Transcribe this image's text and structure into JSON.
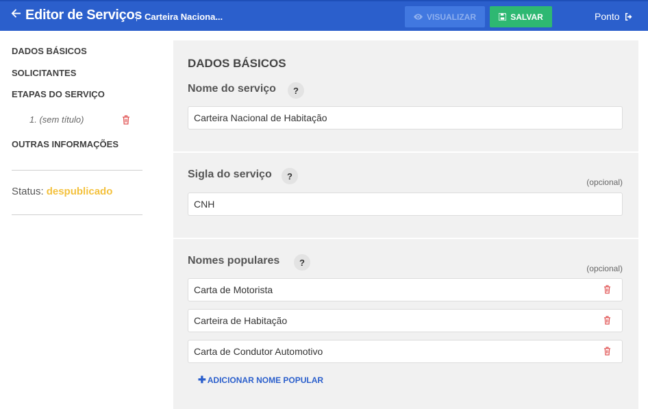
{
  "header": {
    "title": "Editor de Serviços",
    "document_name": "Carteira Naciona...",
    "view_label": "Visualizar",
    "save_label": "Salvar",
    "user_label": "Ponto"
  },
  "sidebar": {
    "items": [
      "DADOS BÁSICOS",
      "SOLICITANTES",
      "ETAPAS DO SERVIÇO",
      "OUTRAS INFORMAÇÕES"
    ],
    "step": "1. (sem título)",
    "status_label": "Status:",
    "status_value": "despublicado"
  },
  "main": {
    "section_title": "DADOS BÁSICOS",
    "service_name_label": "Nome do serviço",
    "service_name_value": "Carteira Nacional de Habitação",
    "acronym_label": "Sigla do serviço",
    "acronym_value": "CNH",
    "optional_text": "(opcional)",
    "popular_names_label": "Nomes populares",
    "popular_names": [
      "Carta de Motorista",
      "Carteira de Habitação",
      "Carta de Condutor Automotivo"
    ],
    "add_popular_label": "ADICIONAR NOME POPULAR",
    "help_symbol": "?"
  },
  "colors": {
    "header_bg": "#2b5fcc",
    "save_button": "#2eb872",
    "status_value": "#f4c13d",
    "trash_icon": "#e05050",
    "link": "#2b5fcc"
  }
}
